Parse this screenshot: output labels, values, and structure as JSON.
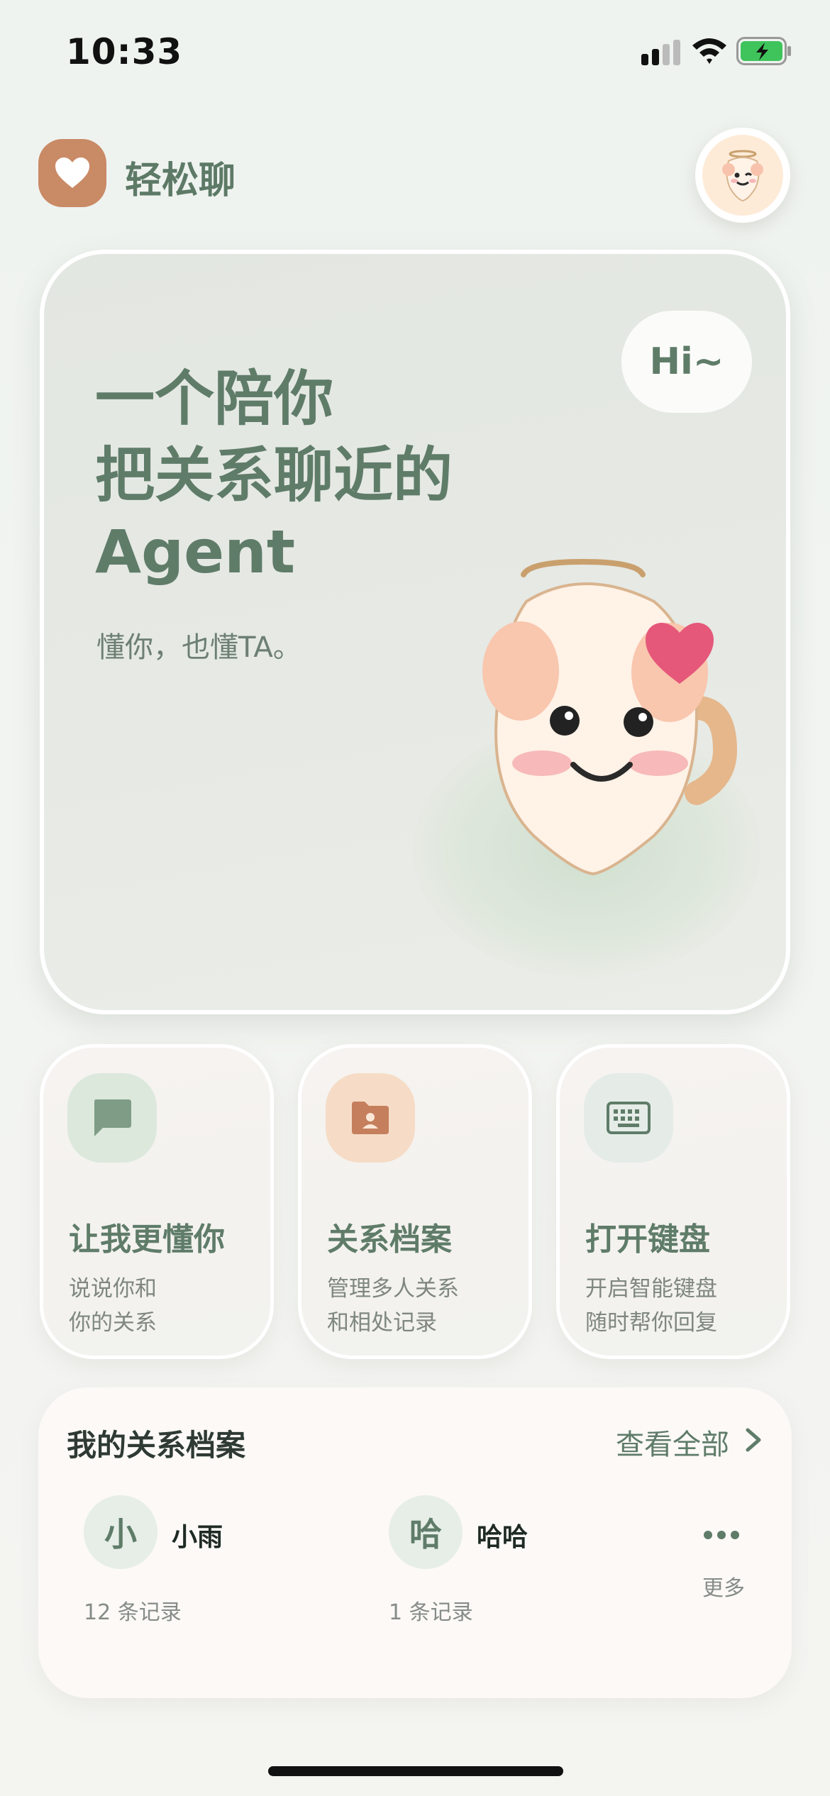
{
  "status_bar": {
    "time": "10:33"
  },
  "header": {
    "app_name": "轻松聊",
    "logo_icon": "heart-icon",
    "avatar_icon": "mascot-avatar-icon"
  },
  "hero": {
    "title_lines": [
      "一个陪你",
      "把关系聊近的",
      "Agent"
    ],
    "subtitle": "懂你，也懂TA。",
    "bubble_text": "Hi~"
  },
  "features": [
    {
      "title": "让我更懂你",
      "desc_lines": [
        "说说你和",
        "你的关系"
      ],
      "icon": "chat-bubble-icon",
      "icon_bg": "#dce8dc",
      "icon_color": "#7f9c86"
    },
    {
      "title": "关系档案",
      "desc_lines": [
        "管理多人关系",
        "和相处记录"
      ],
      "icon": "folder-contact-icon",
      "icon_bg": "#f6dcc6",
      "icon_color": "#c57f5d"
    },
    {
      "title": "打开键盘",
      "desc_lines": [
        "开启智能键盘",
        "随时帮你回复"
      ],
      "icon": "keyboard-icon",
      "icon_bg": "#e5ece7",
      "icon_color": "#5f7c69"
    }
  ],
  "relationships": {
    "section_title": "我的关系档案",
    "view_all": "查看全部",
    "profiles": [
      {
        "initial": "小",
        "name": "小雨",
        "count": "12 条记录"
      },
      {
        "initial": "哈",
        "name": "哈哈",
        "count": "1 条记录"
      }
    ],
    "more_label": "更多"
  },
  "colors": {
    "accent": "#5f7c69",
    "logo": "#c98a66",
    "heart": "#e5587a",
    "background": "#eff3ef"
  }
}
